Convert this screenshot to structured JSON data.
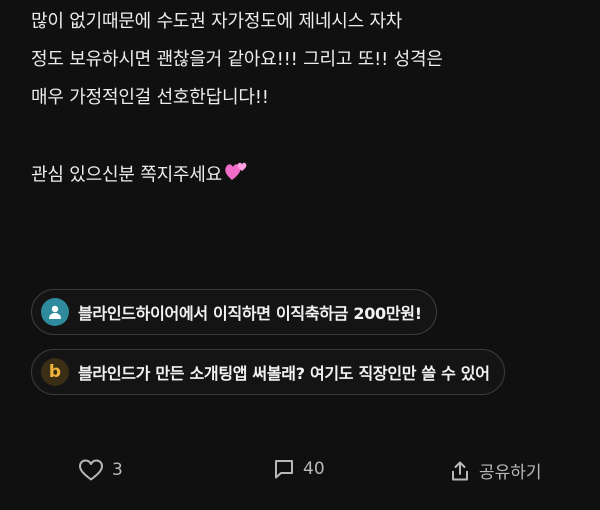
{
  "post": {
    "lines": [
      "많이 없기때문에 수도권 자가정도에 제네시스 자차",
      "정도 보유하시면 괜찮을거 같아요!!! 그리고 또!! 성격은",
      "매우 가정적인걸 선호한답니다!!",
      "",
      "관심 있으신분 쪽지주세요"
    ],
    "emoji": "two-hearts-icon"
  },
  "promos": [
    {
      "icon": "person-icon",
      "text": "블라인드하이어에서 이직하면 이직축하금 200만원!"
    },
    {
      "icon": "b-logo-icon",
      "icon_letter": "b",
      "text": "블라인드가 만든 소개팅앱 써볼래? 여기도 직장인만 쓸 수 있어"
    }
  ],
  "actions": {
    "like_count": "3",
    "comment_count": "40",
    "share_label": "공유하기"
  },
  "colors": {
    "background": "#101010",
    "text": "#ececec",
    "action_text": "#b8b8b8",
    "person_icon_bg": "#2f8a9e",
    "b_icon_color": "#f2b43a"
  }
}
